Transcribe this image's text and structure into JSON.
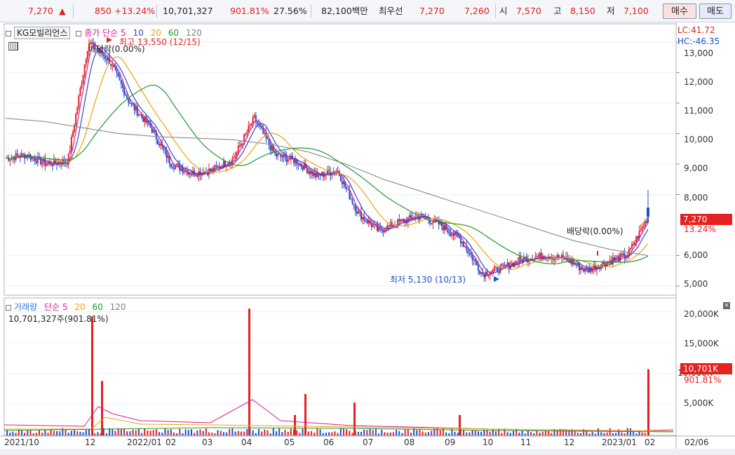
{
  "quote_bar": {
    "price": "7,270",
    "up_arrow": "▲",
    "change": "850",
    "change_pct": "+13.24%",
    "volume": "10,701,327",
    "volume_ratio": "901.81%",
    "turnover": "27.56%",
    "amount": "82,100백만",
    "best_ask_label": "최우선",
    "best_ask": "7,270",
    "best_bid": "7,260",
    "open_label": "시",
    "open": "7,570",
    "high_label": "고",
    "high": "8,150",
    "low_label": "저",
    "low": "7,100",
    "buy_button": "매수",
    "sell_button": "매도"
  },
  "price_panel": {
    "stock_name": "KG모빌리언스",
    "ma_title": "종가 단순",
    "ma_periods": [
      "5",
      "10",
      "20",
      "60",
      "120"
    ],
    "lc": "LC:41.72",
    "hc": "HC:-46.35",
    "y_ticks": [
      "13,000",
      "12,000",
      "11,000",
      "10,000",
      "9,000",
      "8,000",
      "6,000",
      "5,000"
    ],
    "current_tag": "7,270",
    "current_pct": "13.24%",
    "high_annotation": "최고 13,550 (12/15)",
    "low_annotation": "최저 5,130 (10/13)",
    "dividend_1": "배당락(0.00%)",
    "dividend_2": "배당락(0.00%)"
  },
  "volume_panel": {
    "title": "거래량",
    "ma_title": "단순",
    "ma_periods": [
      "5",
      "20",
      "60",
      "120"
    ],
    "volume_text": "10,701,327주(901.81%)",
    "y_ticks": [
      "20,000K",
      "15,000K",
      "10,000K",
      "5,000K"
    ],
    "current_tag": "10,701K",
    "current_pct": "901.81%"
  },
  "x_axis": [
    "2021/10",
    "12",
    "2022/01",
    "02",
    "03",
    "04",
    "05",
    "06",
    "07",
    "08",
    "09",
    "10",
    "11",
    "12",
    "2023/01",
    "02",
    "02/06"
  ],
  "colors": {
    "up": "#e5221f",
    "down": "#1f4fc8",
    "ma5": "#d81b9f",
    "ma10": "#2c49c9",
    "ma20": "#f0a20a",
    "ma60": "#1c9c2c",
    "ma120": "#808080"
  },
  "chart_data": {
    "type": "candlestick",
    "y_range": [
      4700,
      13600
    ],
    "volume_range_k": [
      0,
      22000
    ],
    "x_months": [
      "2021/10",
      "12",
      "2022/01",
      "02",
      "03",
      "04",
      "05",
      "06",
      "07",
      "08",
      "09",
      "10",
      "11",
      "12",
      "2023/01",
      "02"
    ],
    "close_approx": [
      9200,
      9300,
      9000,
      9100,
      13000,
      12400,
      11000,
      10200,
      9000,
      8700,
      8800,
      9200,
      10500,
      9300,
      9100,
      8600,
      8800,
      7400,
      6800,
      7100,
      7300,
      7000,
      6500,
      5400,
      5600,
      5900,
      6000,
      5900,
      5500,
      5800,
      6000,
      7270
    ],
    "ma120_approx": [
      10500,
      10400,
      10200,
      10000,
      9900,
      9850,
      9800,
      9650,
      9400,
      9000,
      8500,
      8100,
      7700,
      7300,
      6900,
      6500,
      6200,
      6000
    ],
    "volume_spikes_k": [
      19200,
      20500,
      8800,
      6700,
      3300,
      5300,
      3300,
      10701
    ]
  }
}
